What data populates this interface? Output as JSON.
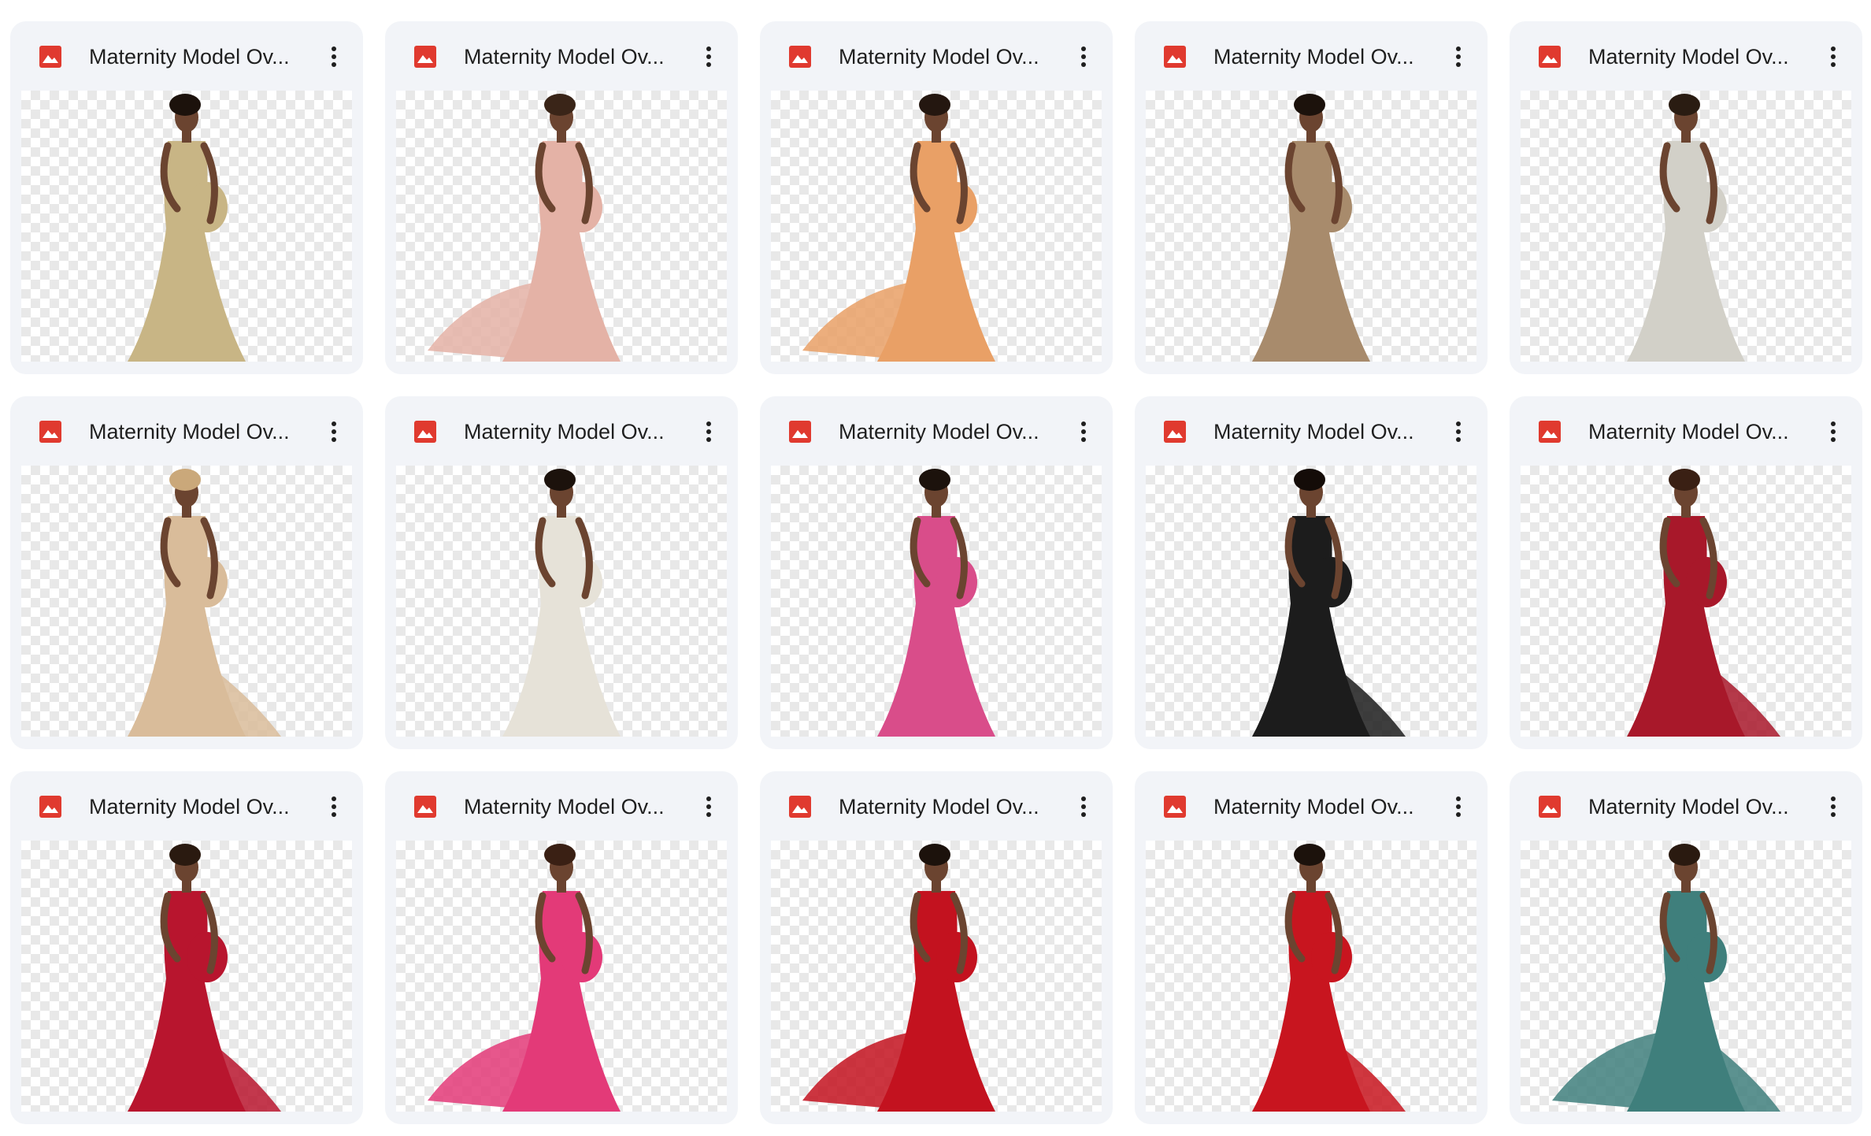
{
  "files": [
    {
      "name": "Maternity Model Ov...",
      "dress": "#c8b585",
      "hair": "#1c120c",
      "train": "none"
    },
    {
      "name": "Maternity Model Ov...",
      "dress": "#e4b2a6",
      "hair": "#3a2518",
      "train": "left"
    },
    {
      "name": "Maternity Model Ov...",
      "dress": "#e9a066",
      "hair": "#241710",
      "train": "left"
    },
    {
      "name": "Maternity Model Ov...",
      "dress": "#a88b6c",
      "hair": "#1c120c",
      "train": "none"
    },
    {
      "name": "Maternity Model Ov...",
      "dress": "#d2d0c8",
      "hair": "#2a1c12",
      "train": "none"
    },
    {
      "name": "Maternity Model Ov...",
      "dress": "#d9bc9a",
      "hair": "#caa87a",
      "train": "right"
    },
    {
      "name": "Maternity Model Ov...",
      "dress": "#e6e2d8",
      "hair": "#1c120c",
      "train": "none"
    },
    {
      "name": "Maternity Model Ov...",
      "dress": "#d94d8a",
      "hair": "#1c120c",
      "train": "none"
    },
    {
      "name": "Maternity Model Ov...",
      "dress": "#1c1c1c",
      "hair": "#140c08",
      "train": "right"
    },
    {
      "name": "Maternity Model Ov...",
      "dress": "#a8182a",
      "hair": "#3a2014",
      "train": "right"
    },
    {
      "name": "Maternity Model Ov...",
      "dress": "#b8152e",
      "hair": "#2a1a10",
      "train": "right"
    },
    {
      "name": "Maternity Model Ov...",
      "dress": "#e33a78",
      "hair": "#3a2014",
      "train": "left"
    },
    {
      "name": "Maternity Model Ov...",
      "dress": "#c3121f",
      "hair": "#1c120c",
      "train": "left"
    },
    {
      "name": "Maternity Model Ov...",
      "dress": "#c8151f",
      "hair": "#1c120c",
      "train": "right"
    },
    {
      "name": "Maternity Model Ov...",
      "dress": "#3f7f7c",
      "hair": "#2a1a10",
      "train": "both"
    }
  ],
  "colors": {
    "card_bg": "#f2f4f8",
    "image_icon": "#e03a2f",
    "more_icon": "#1f1f1f",
    "skin": "#6b4430"
  },
  "icons": {
    "file_type": "image-icon",
    "menu": "more-vert-icon"
  }
}
